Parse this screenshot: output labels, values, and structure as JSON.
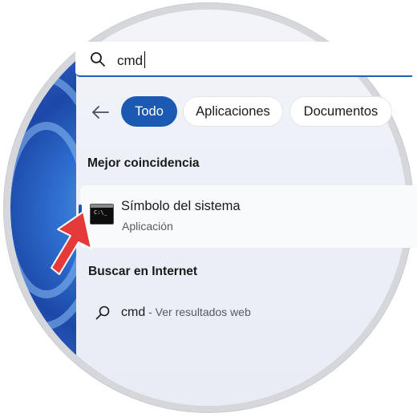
{
  "search": {
    "query": "cmd"
  },
  "filters": {
    "chips": [
      {
        "label": "Todo",
        "active": true
      },
      {
        "label": "Aplicaciones",
        "active": false
      },
      {
        "label": "Documentos",
        "active": false
      }
    ]
  },
  "best_match": {
    "section_title": "Mejor coincidencia",
    "app_name": "Símbolo del sistema",
    "app_type": "Aplicación",
    "icon": "command-prompt-icon",
    "icon_glyph": "C:\\_"
  },
  "web": {
    "section_title": "Buscar en Internet",
    "query": "cmd",
    "hint": " - Ver resultados web",
    "icon": "search-icon"
  },
  "colors": {
    "accent": "#1b59b3",
    "pointer": "#e63a3a"
  }
}
